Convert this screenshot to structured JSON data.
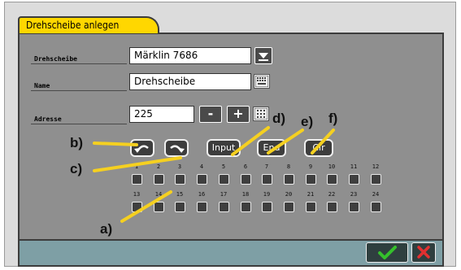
{
  "dialog": {
    "title": "Drehscheibe anlegen"
  },
  "fields": {
    "turntable_label": "Drehscheibe",
    "turntable_value": "Märklin 7686",
    "name_label": "Name",
    "name_value": "Drehscheibe",
    "address_label": "Adresse",
    "address_value": "225"
  },
  "buttons": {
    "minus": "-",
    "plus": "+",
    "input": "Input",
    "end": "End",
    "clr": "Clr"
  },
  "tracks": {
    "row1": [
      "1",
      "2",
      "3",
      "4",
      "5",
      "6",
      "7",
      "8",
      "9",
      "10",
      "11",
      "12"
    ],
    "row2": [
      "13",
      "14",
      "15",
      "16",
      "17",
      "18",
      "19",
      "20",
      "21",
      "22",
      "23",
      "24"
    ]
  },
  "annotations": {
    "a": "a)",
    "b": "b)",
    "c": "c)",
    "d": "d)",
    "e": "e)",
    "f": "f)"
  },
  "colors": {
    "tab": "#ffd700",
    "panel": "#8f8f8f",
    "footer": "#7e9fa5",
    "annotation_line": "#f5d020",
    "ok_check": "#35c02c",
    "cancel_x": "#e23030"
  }
}
